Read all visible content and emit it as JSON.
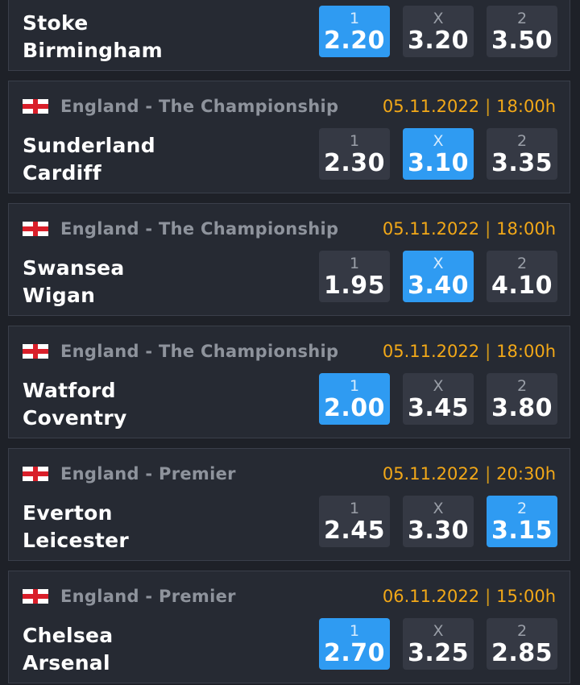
{
  "matches": [
    {
      "league": "",
      "date": "",
      "time": "",
      "home": "Stoke",
      "away": "Birmingham",
      "odds": [
        {
          "label": "1",
          "value": "2.20",
          "selected": true
        },
        {
          "label": "X",
          "value": "3.20",
          "selected": false
        },
        {
          "label": "2",
          "value": "3.50",
          "selected": false
        }
      ]
    },
    {
      "league": "England - The Championship",
      "date": "05.11.2022",
      "time": "18:00h",
      "home": "Sunderland",
      "away": "Cardiff",
      "odds": [
        {
          "label": "1",
          "value": "2.30",
          "selected": false
        },
        {
          "label": "X",
          "value": "3.10",
          "selected": true
        },
        {
          "label": "2",
          "value": "3.35",
          "selected": false
        }
      ]
    },
    {
      "league": "England - The Championship",
      "date": "05.11.2022",
      "time": "18:00h",
      "home": "Swansea",
      "away": "Wigan",
      "odds": [
        {
          "label": "1",
          "value": "1.95",
          "selected": false
        },
        {
          "label": "X",
          "value": "3.40",
          "selected": true
        },
        {
          "label": "2",
          "value": "4.10",
          "selected": false
        }
      ]
    },
    {
      "league": "England - The Championship",
      "date": "05.11.2022",
      "time": "18:00h",
      "home": "Watford",
      "away": "Coventry",
      "odds": [
        {
          "label": "1",
          "value": "2.00",
          "selected": true
        },
        {
          "label": "X",
          "value": "3.45",
          "selected": false
        },
        {
          "label": "2",
          "value": "3.80",
          "selected": false
        }
      ]
    },
    {
      "league": "England - Premier",
      "date": "05.11.2022",
      "time": "20:30h",
      "home": "Everton",
      "away": "Leicester",
      "odds": [
        {
          "label": "1",
          "value": "2.45",
          "selected": false
        },
        {
          "label": "X",
          "value": "3.30",
          "selected": false
        },
        {
          "label": "2",
          "value": "3.15",
          "selected": true
        }
      ]
    },
    {
      "league": "England - Premier",
      "date": "06.11.2022",
      "time": "15:00h",
      "home": "Chelsea",
      "away": "Arsenal",
      "odds": [
        {
          "label": "1",
          "value": "2.70",
          "selected": true
        },
        {
          "label": "X",
          "value": "3.25",
          "selected": false
        },
        {
          "label": "2",
          "value": "2.85",
          "selected": false
        }
      ]
    }
  ],
  "icons": {
    "flag": "england-flag-icon"
  },
  "colors": {
    "background": "#1e2128",
    "card": "#262a33",
    "odd_button": "#353944",
    "odd_selected": "#2f9bf2",
    "league_text": "#8e939c",
    "datetime_text": "#f2a818"
  }
}
